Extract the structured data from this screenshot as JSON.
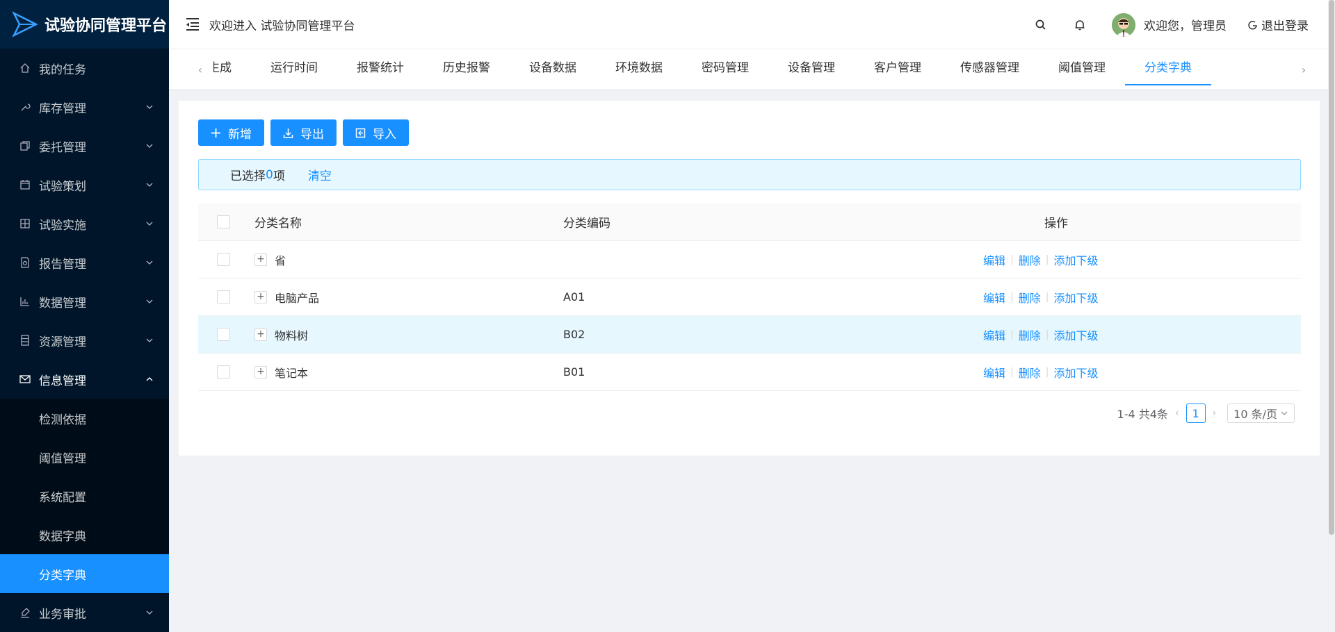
{
  "app": {
    "title": "试验协同管理平台",
    "brand_color": "#1890ff",
    "sidebar_bg": "#001529"
  },
  "sidebar": {
    "items": [
      {
        "label": "我的任务",
        "icon": "home-icon"
      },
      {
        "label": "库存管理",
        "icon": "wrench-icon"
      },
      {
        "label": "委托管理",
        "icon": "copy-icon"
      },
      {
        "label": "试验策划",
        "icon": "calendar-icon"
      },
      {
        "label": "试验实施",
        "icon": "grid-icon"
      },
      {
        "label": "报告管理",
        "icon": "report-icon"
      },
      {
        "label": "数据管理",
        "icon": "bar-chart-icon"
      },
      {
        "label": "资源管理",
        "icon": "database-icon"
      },
      {
        "label": "信息管理",
        "icon": "mail-icon"
      }
    ],
    "sub_items": [
      "检测依据",
      "阈值管理",
      "系统配置",
      "数据字典",
      "分类字典"
    ],
    "bottom_item": {
      "label": "业务审批",
      "icon": "stamp-icon"
    }
  },
  "header": {
    "welcome": "欢迎进入 试验协同管理平台",
    "user_text": "欢迎您，管理员",
    "logout": "退出登录"
  },
  "tabs": [
    "生成",
    "运行时间",
    "报警统计",
    "历史报警",
    "设备数据",
    "环境数据",
    "密码管理",
    "设备管理",
    "客户管理",
    "传感器管理",
    "阈值管理",
    "分类字典"
  ],
  "toolbar": {
    "add": "新增",
    "export": "导出",
    "import": "导入"
  },
  "alert": {
    "prefix": "已选择 ",
    "count": "0",
    "suffix": "项",
    "clear": "清空"
  },
  "table": {
    "headers": {
      "name": "分类名称",
      "code": "分类编码",
      "ops": "操作"
    },
    "rows": [
      {
        "name": "省",
        "code": ""
      },
      {
        "name": "电脑产品",
        "code": "A01"
      },
      {
        "name": "物料树",
        "code": "B02"
      },
      {
        "name": "笔记本",
        "code": "B01"
      }
    ],
    "op_labels": {
      "edit": "编辑",
      "delete": "删除",
      "add_child": "添加下级"
    },
    "expand_symbol": "+"
  },
  "pager": {
    "summary": "1-4 共4条",
    "page": "1",
    "size": "10 条/页"
  }
}
